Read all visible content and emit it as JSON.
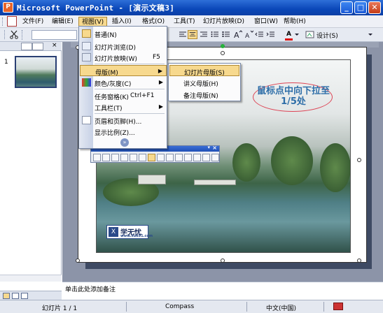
{
  "window": {
    "title": "Microsoft PowerPoint - [演示文稿3]",
    "minimize_glyph": "_",
    "maximize_glyph": "□",
    "close_glyph": "✕"
  },
  "menubar": {
    "items": [
      {
        "label": "文件(F)"
      },
      {
        "label": "编辑(E)"
      },
      {
        "label": "视图(V)"
      },
      {
        "label": "插入(I)"
      },
      {
        "label": "格式(O)"
      },
      {
        "label": "工具(T)"
      },
      {
        "label": "幻灯片放映(D)"
      },
      {
        "label": "窗口(W)"
      },
      {
        "label": "帮助(H)"
      }
    ]
  },
  "toolbar": {
    "design_label": "设计(S)",
    "font_color_letter": "A"
  },
  "view_menu": {
    "items": [
      {
        "label": "普通(N)",
        "shortcut": ""
      },
      {
        "label": "幻灯片浏览(D)",
        "shortcut": ""
      },
      {
        "label": "幻灯片放映(W)",
        "shortcut": "F5"
      },
      {
        "label": "母版(M)",
        "shortcut": ""
      },
      {
        "label": "颜色/灰度(C)",
        "shortcut": ""
      },
      {
        "label": "任务窗格(K)",
        "shortcut": "Ctrl+F1"
      },
      {
        "label": "工具栏(T)",
        "shortcut": ""
      },
      {
        "label": "页眉和页脚(H)...",
        "shortcut": ""
      },
      {
        "label": "显示比例(Z)...",
        "shortcut": ""
      }
    ],
    "expand_glyph": "»"
  },
  "master_submenu": {
    "items": [
      {
        "label": "幻灯片母版(S)"
      },
      {
        "label": "讲义母版(H)"
      },
      {
        "label": "备注母版(N)"
      }
    ]
  },
  "slides_pane": {
    "slide_number": "1"
  },
  "slide": {
    "callout_text": "鼠标点中向下拉至1/5处",
    "logo_name": "学无忧",
    "logo_url": "www.xue51.com"
  },
  "notes": {
    "placeholder": "单击此处添加备注"
  },
  "statusbar": {
    "slide_info": "幻灯片 1 / 1",
    "design": "Compass",
    "language": "中文(中国)"
  }
}
